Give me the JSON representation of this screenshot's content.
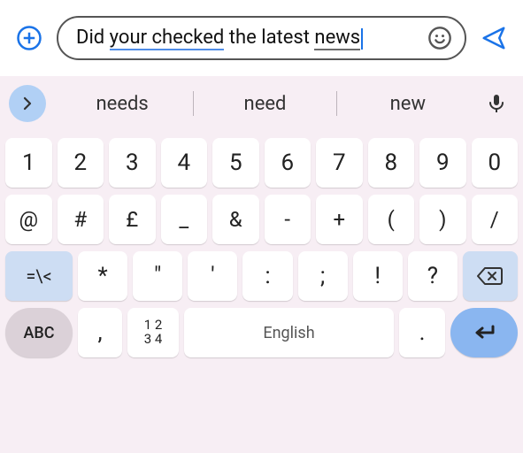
{
  "input": {
    "prefix": "Did ",
    "underlined_blue": "your checked",
    "mid": " the latest ",
    "underlined_grey": "news"
  },
  "suggestions": [
    "needs",
    "need",
    "new"
  ],
  "rows": {
    "r1": [
      "1",
      "2",
      "3",
      "4",
      "5",
      "6",
      "7",
      "8",
      "9",
      "0"
    ],
    "r2": [
      "@",
      "#",
      "£",
      "_",
      "&",
      "-",
      "+",
      "(",
      ")",
      "/"
    ],
    "shift_label": "=\\<",
    "r3": [
      "*",
      "\"",
      "'",
      ":",
      ";",
      "!",
      "?"
    ],
    "abc_label": "ABC",
    "comma": ",",
    "numpad_top": "1 2",
    "numpad_bot": "3 4",
    "space_label": "English",
    "dot": "."
  }
}
